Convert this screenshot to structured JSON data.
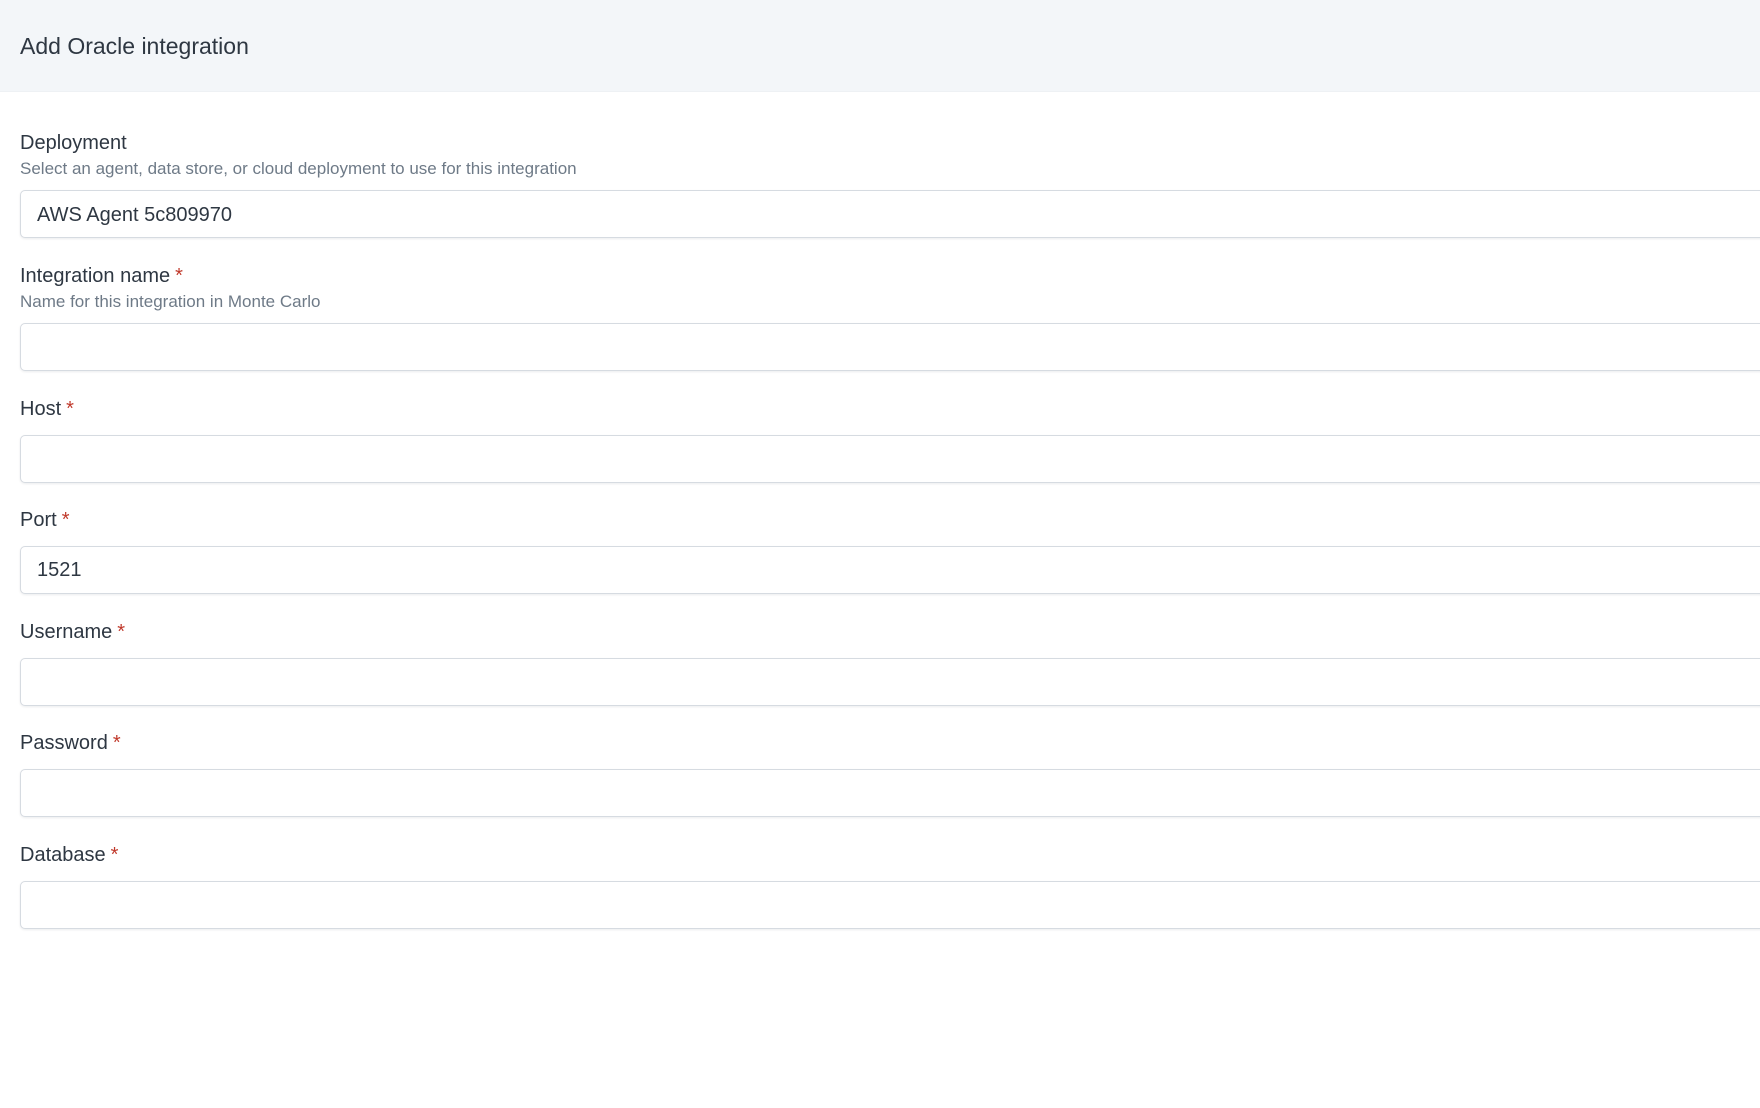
{
  "header": {
    "title": "Add Oracle integration"
  },
  "form": {
    "deployment": {
      "label": "Deployment",
      "help": "Select an agent, data store, or cloud deployment to use for this integration",
      "value": "AWS Agent 5c809970"
    },
    "integration_name": {
      "label": "Integration name",
      "required_mark": "*",
      "help": "Name for this integration in Monte Carlo",
      "value": ""
    },
    "host": {
      "label": "Host",
      "required_mark": "*",
      "value": ""
    },
    "port": {
      "label": "Port",
      "required_mark": "*",
      "value": "1521"
    },
    "username": {
      "label": "Username",
      "required_mark": "*",
      "value": ""
    },
    "password": {
      "label": "Password",
      "required_mark": "*",
      "value": ""
    },
    "database": {
      "label": "Database",
      "required_mark": "*",
      "value": ""
    }
  },
  "colors": {
    "header_bg": "#f3f6f9",
    "required_mark": "#c0392b",
    "help_text": "#6e7a87",
    "input_border": "#d6dbe1"
  }
}
